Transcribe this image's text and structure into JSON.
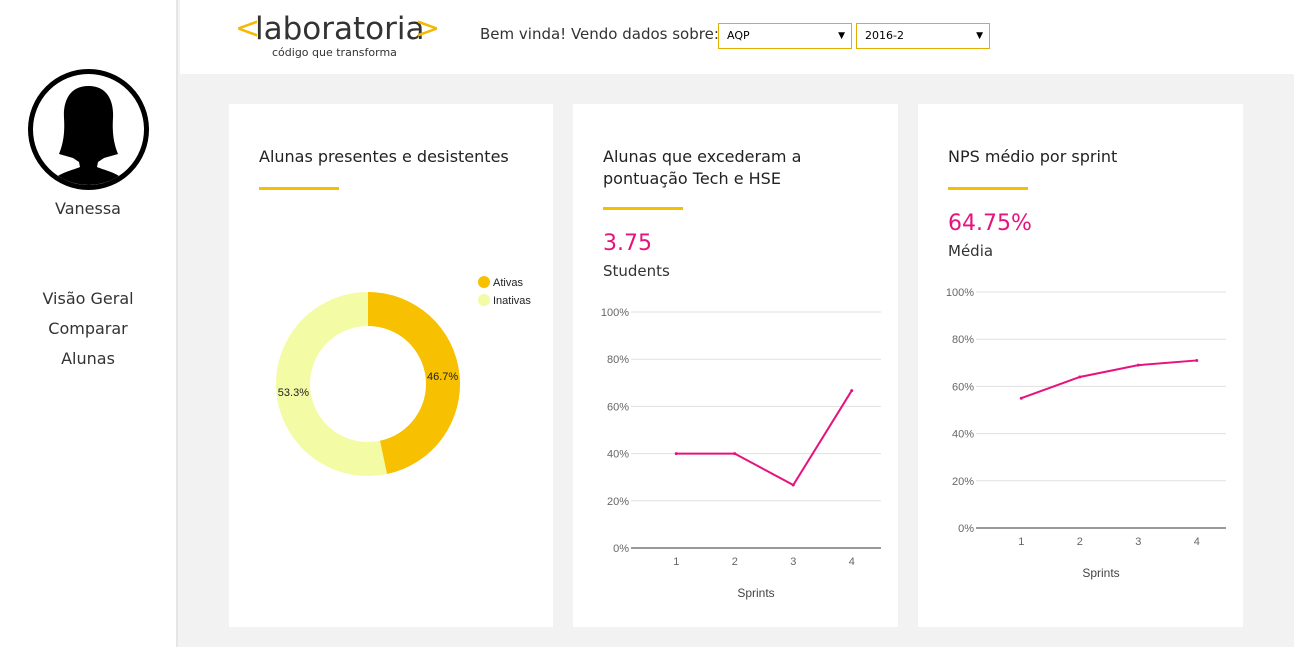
{
  "sidebar": {
    "username": "Vanessa",
    "nav": [
      "Visão Geral",
      "Comparar",
      "Alunas"
    ]
  },
  "header": {
    "logo_word": "laboratoria",
    "logo_bracket_left": "<",
    "logo_bracket_right": ">",
    "logo_tagline": "código que transforma",
    "welcome": "Bem vinda! Vendo dados sobre:",
    "sede_value": "AQP",
    "generation_value": "2016-2"
  },
  "colors": {
    "accent": "#f5c000",
    "pink": "#e6127e",
    "pale": "#f3fba5"
  },
  "cards": [
    {
      "title": "Alunas presentes e desistentes"
    },
    {
      "title": "Alunas que excederam a pontuação Tech e HSE",
      "value": "3.75",
      "subtitle": "Students"
    },
    {
      "title": "NPS médio por sprint",
      "value": "64.75%",
      "subtitle": "Média"
    }
  ],
  "chart_data": [
    {
      "type": "pie",
      "title": "Alunas presentes e desistentes",
      "labels": [
        "Ativas",
        "Inativas"
      ],
      "values": [
        46.7,
        53.3
      ],
      "value_labels": [
        "46.7%",
        "53.3%"
      ],
      "colors": [
        "#f7c000",
        "#f3fba5"
      ],
      "legend": "top-right"
    },
    {
      "type": "line",
      "title": "Alunas que excederam a pontuação Tech e HSE",
      "x": [
        1,
        2,
        3,
        4
      ],
      "xticks": [
        "1",
        "2",
        "3",
        "4"
      ],
      "series": [
        {
          "values": [
            40,
            40,
            26.7,
            66.7
          ]
        }
      ],
      "xlabel": "Sprints",
      "ylim": [
        0,
        100
      ],
      "yticks": [
        "0%",
        "20%",
        "40%",
        "60%",
        "80%",
        "100%"
      ],
      "grid": true,
      "color": "#e6127e"
    },
    {
      "type": "line",
      "title": "NPS médio por sprint",
      "x": [
        1,
        2,
        3,
        4
      ],
      "xticks": [
        "1",
        "2",
        "3",
        "4"
      ],
      "series": [
        {
          "values": [
            55,
            64,
            69,
            71
          ]
        }
      ],
      "xlabel": "Sprints",
      "ylim": [
        0,
        100
      ],
      "yticks": [
        "0%",
        "20%",
        "40%",
        "60%",
        "80%",
        "100%"
      ],
      "grid": true,
      "color": "#e6127e"
    }
  ]
}
